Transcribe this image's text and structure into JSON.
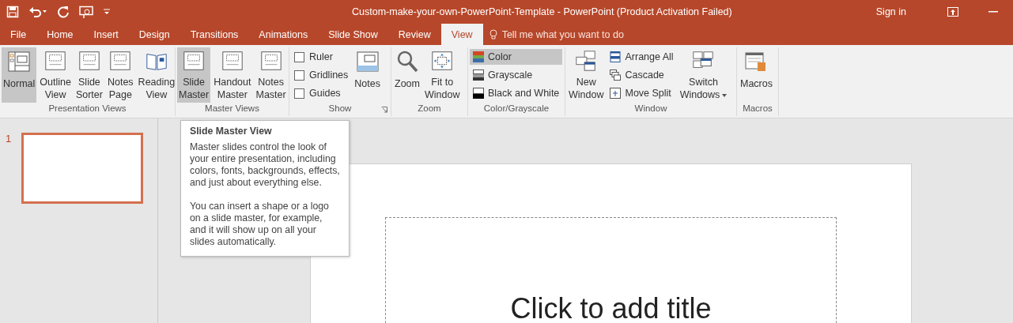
{
  "window": {
    "title": "Custom-make-your-own-PowerPoint-Template  -  PowerPoint (Product Activation Failed)",
    "sign_in": "Sign in"
  },
  "tabs": [
    {
      "label": "File",
      "selected": false
    },
    {
      "label": "Home",
      "selected": false
    },
    {
      "label": "Insert",
      "selected": false
    },
    {
      "label": "Design",
      "selected": false
    },
    {
      "label": "Transitions",
      "selected": false
    },
    {
      "label": "Animations",
      "selected": false
    },
    {
      "label": "Slide Show",
      "selected": false
    },
    {
      "label": "Review",
      "selected": false
    },
    {
      "label": "View",
      "selected": true
    }
  ],
  "tell_me": "Tell me what you want to do",
  "ribbon": [
    {
      "label": "Presentation Views",
      "items": [
        {
          "kind": "large",
          "lines": [
            "Normal"
          ],
          "selected": true
        },
        {
          "kind": "large",
          "lines": [
            "Outline",
            "View"
          ],
          "selected": false
        },
        {
          "kind": "large",
          "lines": [
            "Slide",
            "Sorter"
          ],
          "selected": false
        },
        {
          "kind": "large",
          "lines": [
            "Notes",
            "Page"
          ],
          "selected": false
        },
        {
          "kind": "large",
          "lines": [
            "Reading",
            "View"
          ],
          "selected": false
        }
      ]
    },
    {
      "label": "Master Views",
      "items": [
        {
          "kind": "large",
          "lines": [
            "Slide",
            "Master"
          ],
          "selected": true
        },
        {
          "kind": "large",
          "lines": [
            "Handout",
            "Master"
          ],
          "selected": false
        },
        {
          "kind": "large",
          "lines": [
            "Notes",
            "Master"
          ],
          "selected": false
        }
      ]
    },
    {
      "label": "Show",
      "launcher": true,
      "items": [
        {
          "kind": "stack",
          "items": [
            {
              "kind": "check",
              "label": "Ruler",
              "checked": false
            },
            {
              "kind": "check",
              "label": "Gridlines",
              "checked": false
            },
            {
              "kind": "check",
              "label": "Guides",
              "checked": false
            }
          ]
        },
        {
          "kind": "large",
          "lines": [
            "Notes"
          ],
          "selected": false
        }
      ]
    },
    {
      "label": "Zoom",
      "items": [
        {
          "kind": "large",
          "lines": [
            "Zoom"
          ],
          "selected": false
        },
        {
          "kind": "large",
          "lines": [
            "Fit to",
            "Window"
          ],
          "selected": false
        }
      ]
    },
    {
      "label": "Color/Grayscale",
      "items": [
        {
          "kind": "stack",
          "items": [
            {
              "kind": "small",
              "label": "Color",
              "selected": true
            },
            {
              "kind": "small",
              "label": "Grayscale",
              "selected": false
            },
            {
              "kind": "small",
              "label": "Black and White",
              "selected": false
            }
          ]
        }
      ]
    },
    {
      "label": "Window",
      "items": [
        {
          "kind": "large",
          "lines": [
            "New",
            "Window"
          ],
          "selected": false
        },
        {
          "kind": "stack",
          "items": [
            {
              "kind": "small",
              "label": "Arrange All",
              "selected": false
            },
            {
              "kind": "small",
              "label": "Cascade",
              "selected": false
            },
            {
              "kind": "small",
              "label": "Move Split",
              "selected": false
            }
          ]
        },
        {
          "kind": "large",
          "lines": [
            "Switch",
            "Windows"
          ],
          "dropdown": true,
          "selected": false
        }
      ]
    },
    {
      "label": "Macros",
      "items": [
        {
          "kind": "large",
          "lines": [
            "Macros"
          ],
          "selected": false
        }
      ]
    }
  ],
  "thumbnails": [
    {
      "number": "1",
      "selected": true
    }
  ],
  "slide": {
    "title_placeholder": "Click to add title"
  },
  "tooltip": {
    "title": "Slide Master View",
    "paragraphs": [
      "Master slides control the look of your entire presentation, including colors, fonts, backgrounds, effects, and just about everything else.",
      "You can insert a shape or a logo on a slide master, for example, and it will show up on all your slides automatically."
    ]
  }
}
